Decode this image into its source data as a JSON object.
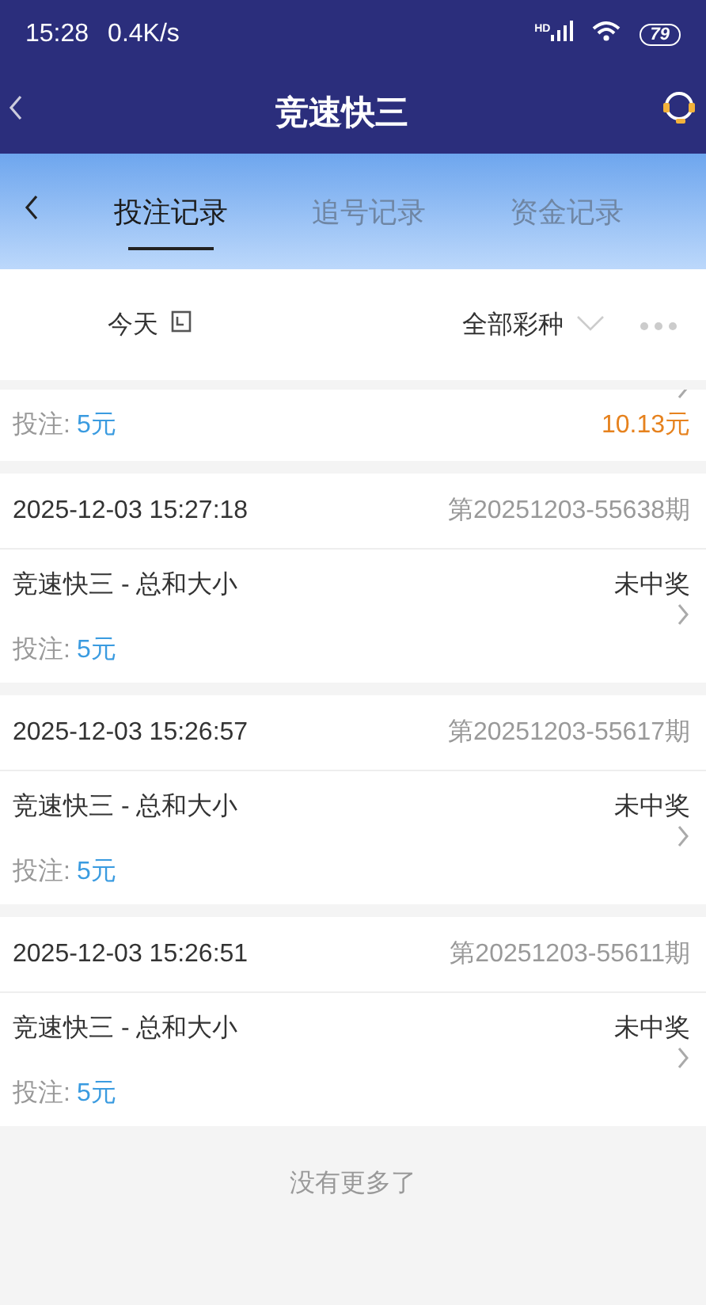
{
  "status_bar": {
    "time": "15:28",
    "speed": "0.4K/s",
    "hd_label": "HD",
    "battery": "79"
  },
  "header": {
    "title": "竞速快三"
  },
  "tabs": [
    {
      "label": "投注记录",
      "selected": true
    },
    {
      "label": "追号记录",
      "selected": false
    },
    {
      "label": "资金记录",
      "selected": false
    }
  ],
  "filter": {
    "date": "今天",
    "lottery": "全部彩种"
  },
  "bets": [
    {
      "kind": "partial",
      "stake_label": "投注:",
      "stake": "5元",
      "win": "10.13元"
    },
    {
      "kind": "full",
      "time": "2025-12-03 15:27:18",
      "period": "第20251203-55638期",
      "game": "竞速快三 - 总和大小",
      "result": "未中奖",
      "stake_label": "投注:",
      "stake": "5元"
    },
    {
      "kind": "full",
      "time": "2025-12-03 15:26:57",
      "period": "第20251203-55617期",
      "game": "竞速快三 - 总和大小",
      "result": "未中奖",
      "stake_label": "投注:",
      "stake": "5元"
    },
    {
      "kind": "full",
      "time": "2025-12-03 15:26:51",
      "period": "第20251203-55611期",
      "game": "竞速快三 - 总和大小",
      "result": "未中奖",
      "stake_label": "投注:",
      "stake": "5元"
    }
  ],
  "footer": {
    "text": "没有更多了"
  }
}
